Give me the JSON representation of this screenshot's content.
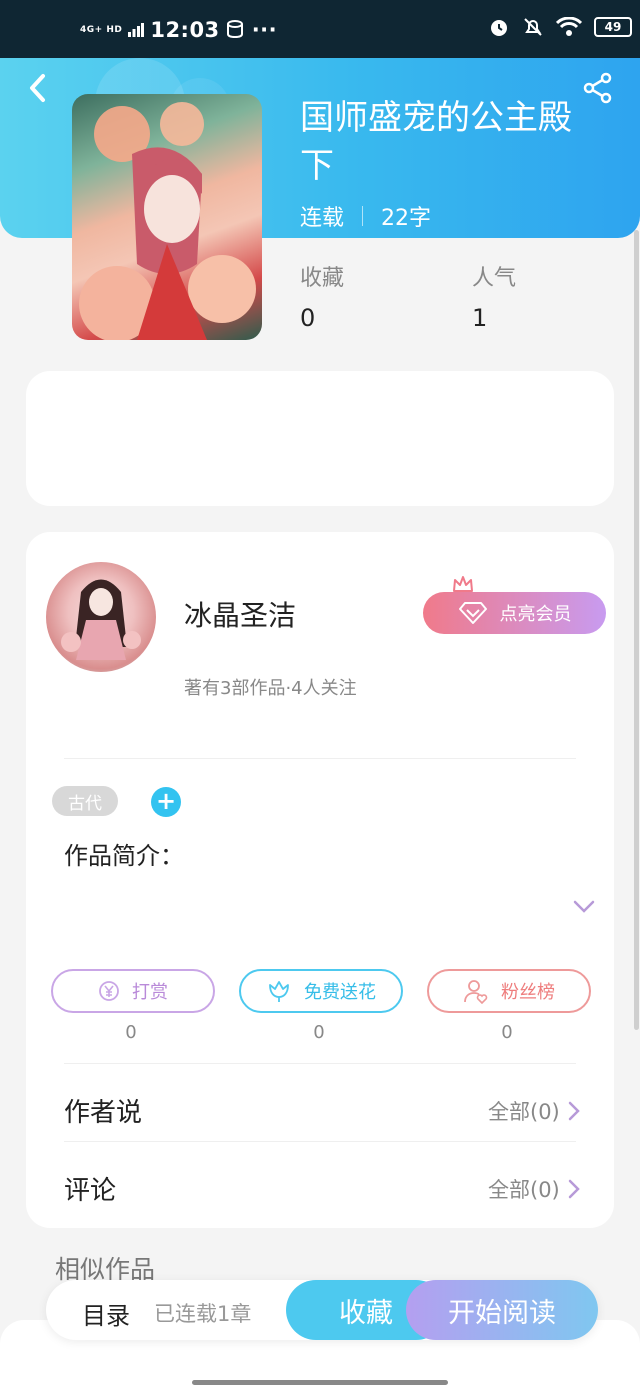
{
  "status_bar": {
    "network": "4G+ HD",
    "time": "12:03",
    "more": "···",
    "battery": "49"
  },
  "book": {
    "title": "国师盛宠的公主殿下",
    "status": "连载",
    "word_count": "22字",
    "favorites_label": "收藏",
    "favorites_value": "0",
    "popularity_label": "人气",
    "popularity_value": "1"
  },
  "author": {
    "name": "冰晶圣洁",
    "info": "著有3部作品·4人关注",
    "vip_label": "点亮会员"
  },
  "tags": [
    "古代"
  ],
  "intro_label": "作品简介：",
  "actions": [
    {
      "label": "打赏",
      "count": "0",
      "color": "#b98ad9",
      "icon": "yen-coin-icon"
    },
    {
      "label": "免费送花",
      "count": "0",
      "color": "#36bde8",
      "icon": "flower-icon"
    },
    {
      "label": "粉丝榜",
      "count": "0",
      "color": "#ee7d7d",
      "icon": "fan-user-icon"
    }
  ],
  "rows": {
    "author_says": {
      "label": "作者说",
      "right": "全部(0)"
    },
    "comments": {
      "label": "评论",
      "right": "全部(0)"
    }
  },
  "similar_label": "相似作品",
  "bottom_bar": {
    "toc_label": "目录",
    "chapters": "已连载1章",
    "favorite_label": "收藏",
    "read_label": "开始阅读"
  },
  "colors": {
    "header_gradient": [
      "#5bd2ef",
      "#2ea4ef"
    ],
    "accent_blue": "#33c3f0",
    "vip_gradient": [
      "#f07a8a",
      "#c89bf0"
    ]
  }
}
